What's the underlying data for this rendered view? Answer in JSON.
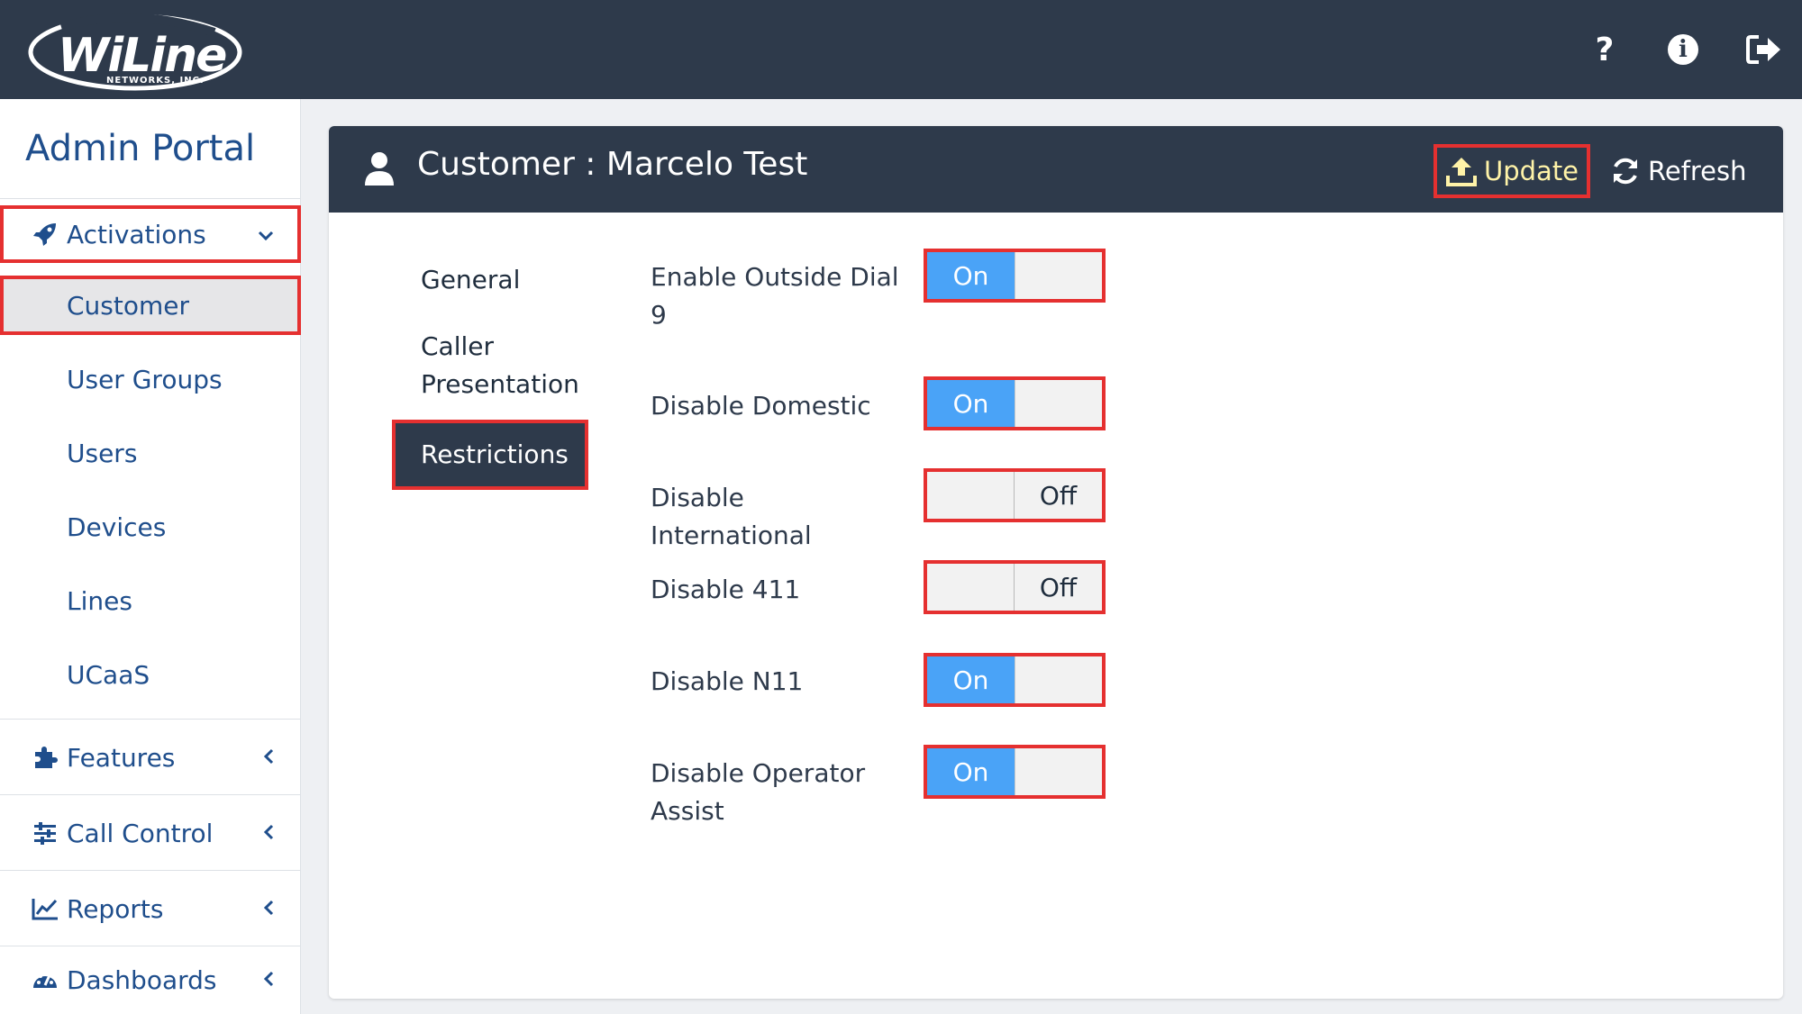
{
  "brand": {
    "logo_text": "WiLine",
    "logo_subtext": "NETWORKS, INC."
  },
  "topbar": {
    "help_icon": "question-icon",
    "info_icon": "info-icon",
    "logout_icon": "logout-icon"
  },
  "sidebar": {
    "title": "Admin Portal",
    "sections": [
      {
        "label": "Activations",
        "icon": "rocket-icon",
        "expanded": true
      },
      {
        "label": "Features",
        "icon": "puzzle-icon",
        "expanded": false
      },
      {
        "label": "Call Control",
        "icon": "sliders-icon",
        "expanded": false
      },
      {
        "label": "Reports",
        "icon": "line-chart-icon",
        "expanded": false
      },
      {
        "label": "Dashboards",
        "icon": "gauge-icon",
        "expanded": false
      }
    ],
    "activation_items": [
      {
        "label": "Customer",
        "active": true
      },
      {
        "label": "User Groups"
      },
      {
        "label": "Users"
      },
      {
        "label": "Devices"
      },
      {
        "label": "Lines"
      },
      {
        "label": "UCaaS"
      }
    ]
  },
  "card": {
    "title": "Customer : Marcelo Test",
    "update_label": "Update",
    "refresh_label": "Refresh"
  },
  "tabs": [
    {
      "label": "General"
    },
    {
      "label": "Caller Presentation"
    },
    {
      "label": "Restrictions",
      "active": true
    }
  ],
  "restrictions": [
    {
      "label": "Enable Outside Dial 9",
      "state": "On"
    },
    {
      "label": "Disable Domestic",
      "state": "On"
    },
    {
      "label": "Disable International",
      "state": "Off"
    },
    {
      "label": "Disable 411",
      "state": "Off"
    },
    {
      "label": "Disable N11",
      "state": "On"
    },
    {
      "label": "Disable Operator Assist",
      "state": "On"
    }
  ],
  "colors": {
    "header_bg": "#2e3a4b",
    "accent_blue": "#4aa3f7",
    "nav_text": "#1f4e8c",
    "highlight_red": "#e53030",
    "update_text": "#fff3a8"
  }
}
